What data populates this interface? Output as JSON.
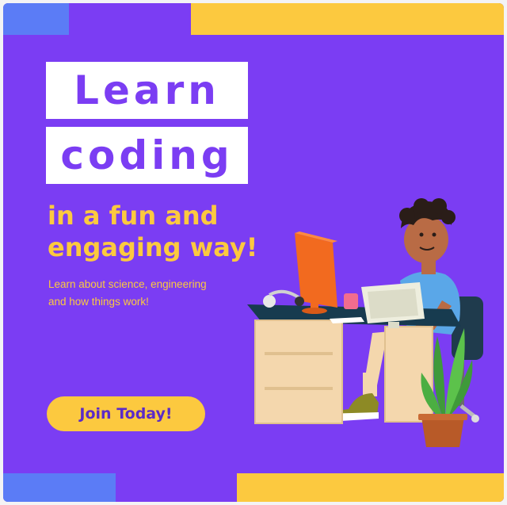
{
  "heading": {
    "line1": "Learn",
    "line2": "coding"
  },
  "subtitle": {
    "line1": "in a fun and",
    "line2": "engaging way!"
  },
  "description": {
    "line1": "Learn about science, engineering",
    "line2": "and how things work!"
  },
  "cta": {
    "label": "Join Today!"
  },
  "colors": {
    "background": "#7b3df3",
    "accent_yellow": "#fcc93f",
    "accent_blue": "#5b7cf6",
    "white": "#ffffff"
  },
  "illustration": {
    "icon": "person-at-computer-desk-illustration"
  }
}
